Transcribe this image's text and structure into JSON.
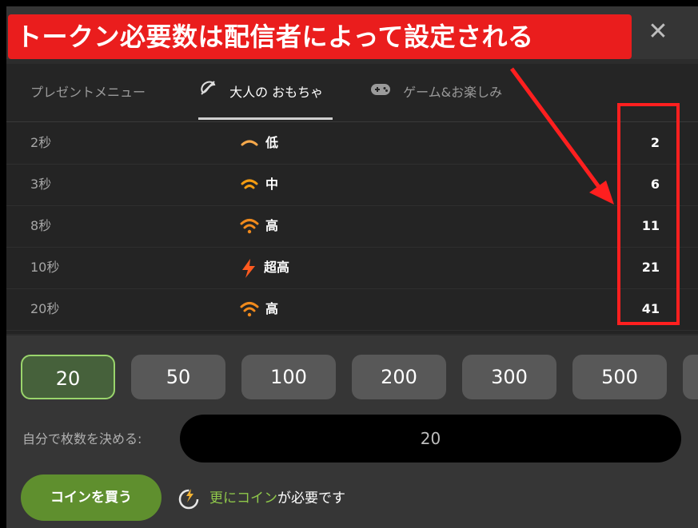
{
  "annotation": {
    "banner_text": "トークン必要数は配信者によって設定される",
    "banner_color": "#ea1d1d"
  },
  "header": {
    "close_glyph": "✕"
  },
  "tabs": [
    {
      "label": "プレゼントメニュー",
      "icon": null,
      "active": false
    },
    {
      "label": "大人の おもちゃ",
      "icon": "toy-icon",
      "active": true
    },
    {
      "label": "ゲーム&お楽しみ",
      "icon": "gamepad-icon",
      "active": false
    }
  ],
  "rows": [
    {
      "duration": "2秒",
      "level": "低",
      "icon": "signal-low-icon",
      "tokens": "2"
    },
    {
      "duration": "3秒",
      "level": "中",
      "icon": "signal-medium-icon",
      "tokens": "6"
    },
    {
      "duration": "8秒",
      "level": "高",
      "icon": "signal-high-icon",
      "tokens": "11"
    },
    {
      "duration": "10秒",
      "level": "超高",
      "icon": "lightning-icon",
      "tokens": "21"
    },
    {
      "duration": "20秒",
      "level": "高",
      "icon": "signal-high-icon",
      "tokens": "41"
    }
  ],
  "amounts": [
    "20",
    "50",
    "100",
    "200",
    "300",
    "500"
  ],
  "selected_amount": "20",
  "custom": {
    "label": "自分で枚数を決める:",
    "value": "20"
  },
  "buy_button": "コインを買う",
  "need_message": {
    "highlight": "更にコイン",
    "rest": "が必要です"
  },
  "colors": {
    "accent_green": "#8fc84a",
    "signal_orange": "#f39c12",
    "highlight_red": "#ff1f1f"
  }
}
